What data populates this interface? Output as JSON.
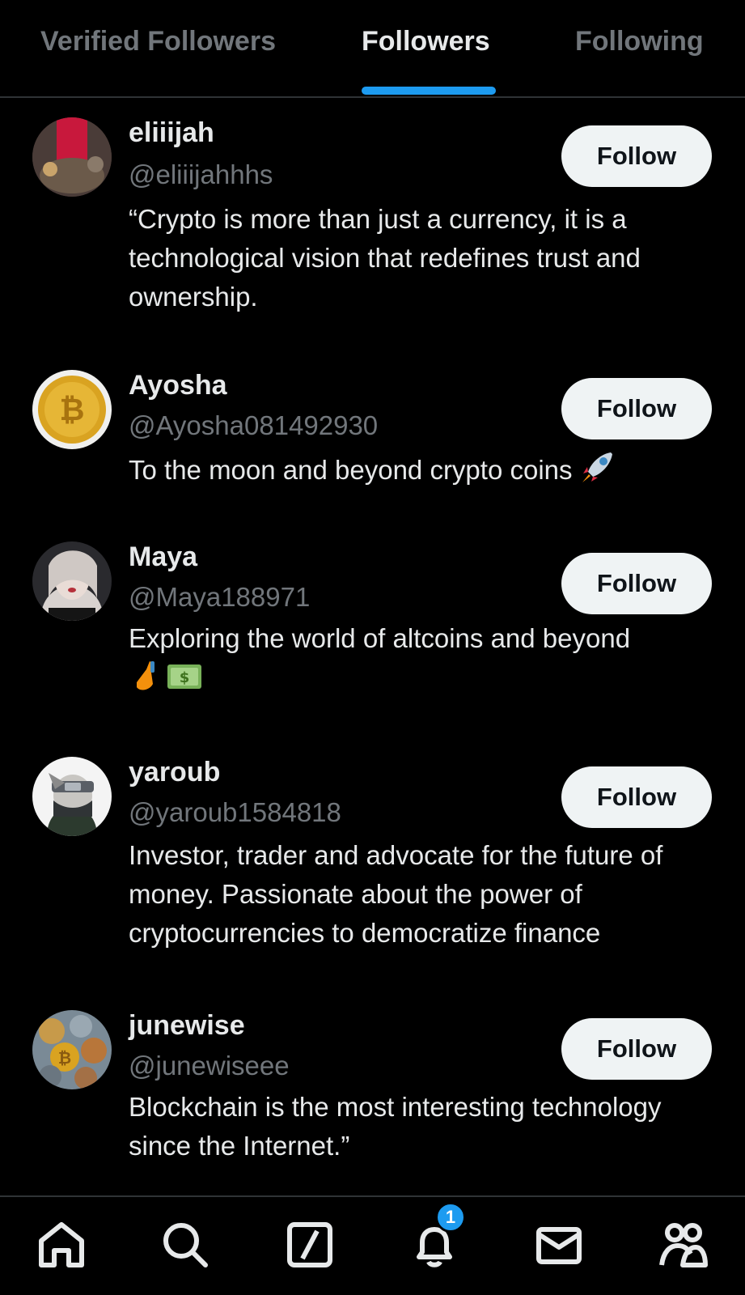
{
  "tabs": [
    {
      "label": "Verified Followers",
      "active": false
    },
    {
      "label": "Followers",
      "active": true
    },
    {
      "label": "Following",
      "active": false
    }
  ],
  "accent_color": "#1d9bf0",
  "followers": [
    {
      "name": "eliiijah",
      "handle": "@eliiijahhhs",
      "bio": "“Crypto is more than just a currency, it is a technological vision that redefines trust and ownership.",
      "button": "Follow",
      "avatar": "red-figure-avatar"
    },
    {
      "name": "Ayosha",
      "handle": "@Ayosha081492930",
      "bio": "To the moon and beyond crypto coins",
      "bio_emoji": "rocket-emoji",
      "button": "Follow",
      "avatar": "bitcoin-coin-avatar"
    },
    {
      "name": "Maya",
      "handle": "@Maya188971",
      "bio": "Exploring the world of altcoins and beyond",
      "bio_emoji": "hand-and-money-emoji",
      "button": "Follow",
      "avatar": "anime-girl-avatar"
    },
    {
      "name": "yaroub",
      "handle": "@yaroub1584818",
      "bio": "Investor, trader and advocate for the future of money. Passionate about the power of cryptocurrencies to democratize finance",
      "button": "Follow",
      "avatar": "masked-ninja-avatar"
    },
    {
      "name": "junewise",
      "handle": "@junewiseee",
      "bio": "Blockchain is the most interesting technology since the Internet.”",
      "button": "Follow",
      "avatar": "coins-avatar"
    }
  ],
  "bottom_nav": {
    "items": [
      "home-icon",
      "search-icon",
      "grok-icon",
      "notifications-icon",
      "messages-icon",
      "communities-icon"
    ],
    "notification_badge": "1"
  }
}
